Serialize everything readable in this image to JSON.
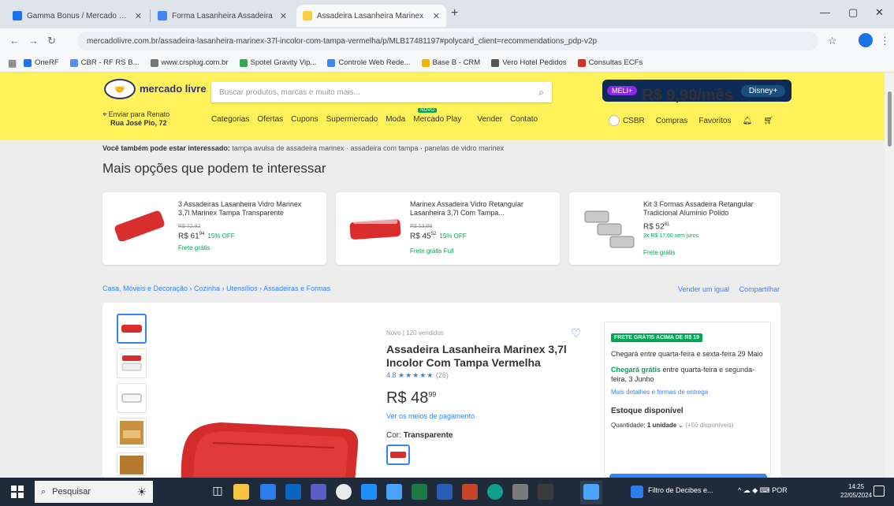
{
  "browser": {
    "tabs": [
      {
        "label": "Gamma Bonus / Mercado Livre",
        "active": false,
        "color": "#1a73e8"
      },
      {
        "label": "Forma Lasanheira Assadeira",
        "active": false,
        "color": "#4285f4"
      },
      {
        "label": "Assadeira Lasanheira Marinex",
        "active": true,
        "color": "#f4d03f"
      }
    ],
    "url": "mercadolivre.com.br/assadeira-lasanheira-marinex-37l-incolor-com-tampa-vermelha/p/MLB17481197#polycard_client=recommendations_pdp-v2p",
    "bookmarks": [
      {
        "label": "OneRF",
        "color": "#1a73e8"
      },
      {
        "label": "CBR - RF RS B...",
        "color": "#5b8def"
      },
      {
        "label": "www.crsplug.com.br",
        "color": "#777777"
      },
      {
        "label": "Spotel Gravity Vip...",
        "color": "#34a853"
      },
      {
        "label": "Controle Web Rede...",
        "color": "#4285f4"
      },
      {
        "label": "Base B - CRM",
        "color": "#f4b400"
      },
      {
        "label": "Vero Hotel Pedidos",
        "color": "#555555"
      },
      {
        "label": "Consultas ECFs",
        "color": "#d93025"
      }
    ]
  },
  "header": {
    "logo_text": "mercado livre",
    "search_placeholder": "Buscar produtos, marcas e muito mais...",
    "promo": {
      "badge": "MELI+",
      "price": "R$ 9,90/mês",
      "partner": "Disney+"
    },
    "location_line1": "Enviar para Renato",
    "location_line2": "Rua José Pio, 72",
    "menu": [
      "Categorias",
      "Ofertas",
      "Cupons",
      "Supermercado",
      "Moda",
      "Mercado Play",
      "Vender",
      "Contato"
    ],
    "menu_new_tag": "NOVO",
    "user": [
      "CSBR",
      "Compras",
      "Favoritos"
    ],
    "icons": [
      "bell-icon",
      "cart-icon"
    ]
  },
  "related": {
    "label": "Você também pode estar interessado:",
    "links": "tampa avulsa de assadeira marinex · assadeira com tampa · panelas de vidro marinex"
  },
  "section_title": "Mais opções que podem te interessar",
  "cards": [
    {
      "title": "3 Assadeiras Lasanheira Vidro Marinex 3,7l Marinex Tampa Transparente",
      "old": "R$ 72,92",
      "price": "R$ 61",
      "cents": "94",
      "off": "15% OFF",
      "ship": "Frete grátis",
      "inst": ""
    },
    {
      "title": "Marinex Assadeira Vidro Retangular Lasanheira 3,7l Com Tampa...",
      "old": "R$ 53,99",
      "price": "R$ 45",
      "cents": "52",
      "off": "15% OFF",
      "ship": "Frete grátis Full",
      "inst": ""
    },
    {
      "title": "Kit 3 Formas Assadeira Retangular Tradicional Alumínio Polido",
      "old": "",
      "price": "R$ 52",
      "cents": "81",
      "off": "",
      "ship": "Frete grátis",
      "inst": "3x R$ 17,60 sem juros"
    }
  ],
  "breadcrumb": "Casa, Móveis e Decoração › Cozinha › Utensílios › Assadeiras e Formas",
  "crumb_right": [
    "Vender um igual",
    "Compartilhar"
  ],
  "product": {
    "condition": "Novo | 120 vendidos",
    "title": "Assadeira Lasanheira Marinex 3,7l Incolor Com Tampa Vermelha",
    "rating": "4.8",
    "stars": "★★★★★",
    "review_count": "(26)",
    "price_int": "R$ 48",
    "price_cents": "99",
    "installments": "Ver os meios de pagamento",
    "color_label": "Cor:",
    "color_value": "Transparente"
  },
  "buybox": {
    "tag": "FRETE GRÁTIS ACIMA DE R$ 19",
    "line1": "Chegará entre quarta-feira e sexta-feira",
    "line2": "29 Maio",
    "green": "Chegará grátis",
    "line3": "entre quarta-feira e segunda-feira, 3 Junho",
    "link": "Mais detalhes e formas de entrega",
    "stock": "Estoque disponível",
    "qty_label": "Quantidade:",
    "qty_value": "1 unidade",
    "qty_avail": "(+50 disponíveis)"
  },
  "taskbar": {
    "search_placeholder": "Pesquisar",
    "pinned": [
      "file-explorer-icon",
      "store-icon",
      "outlook-icon",
      "teams-icon",
      "chrome-icon",
      "mail-icon",
      "onedrive-icon",
      "excel-icon",
      "word-icon",
      "powerpoint-icon",
      "edge-icon",
      "camera-icon",
      "calculator-icon"
    ],
    "active_window": "Filtro de Decibes e...",
    "tray": "^  ☁  ◆  ⌨  POR",
    "time": "14:25",
    "date": "22/05/2024"
  }
}
